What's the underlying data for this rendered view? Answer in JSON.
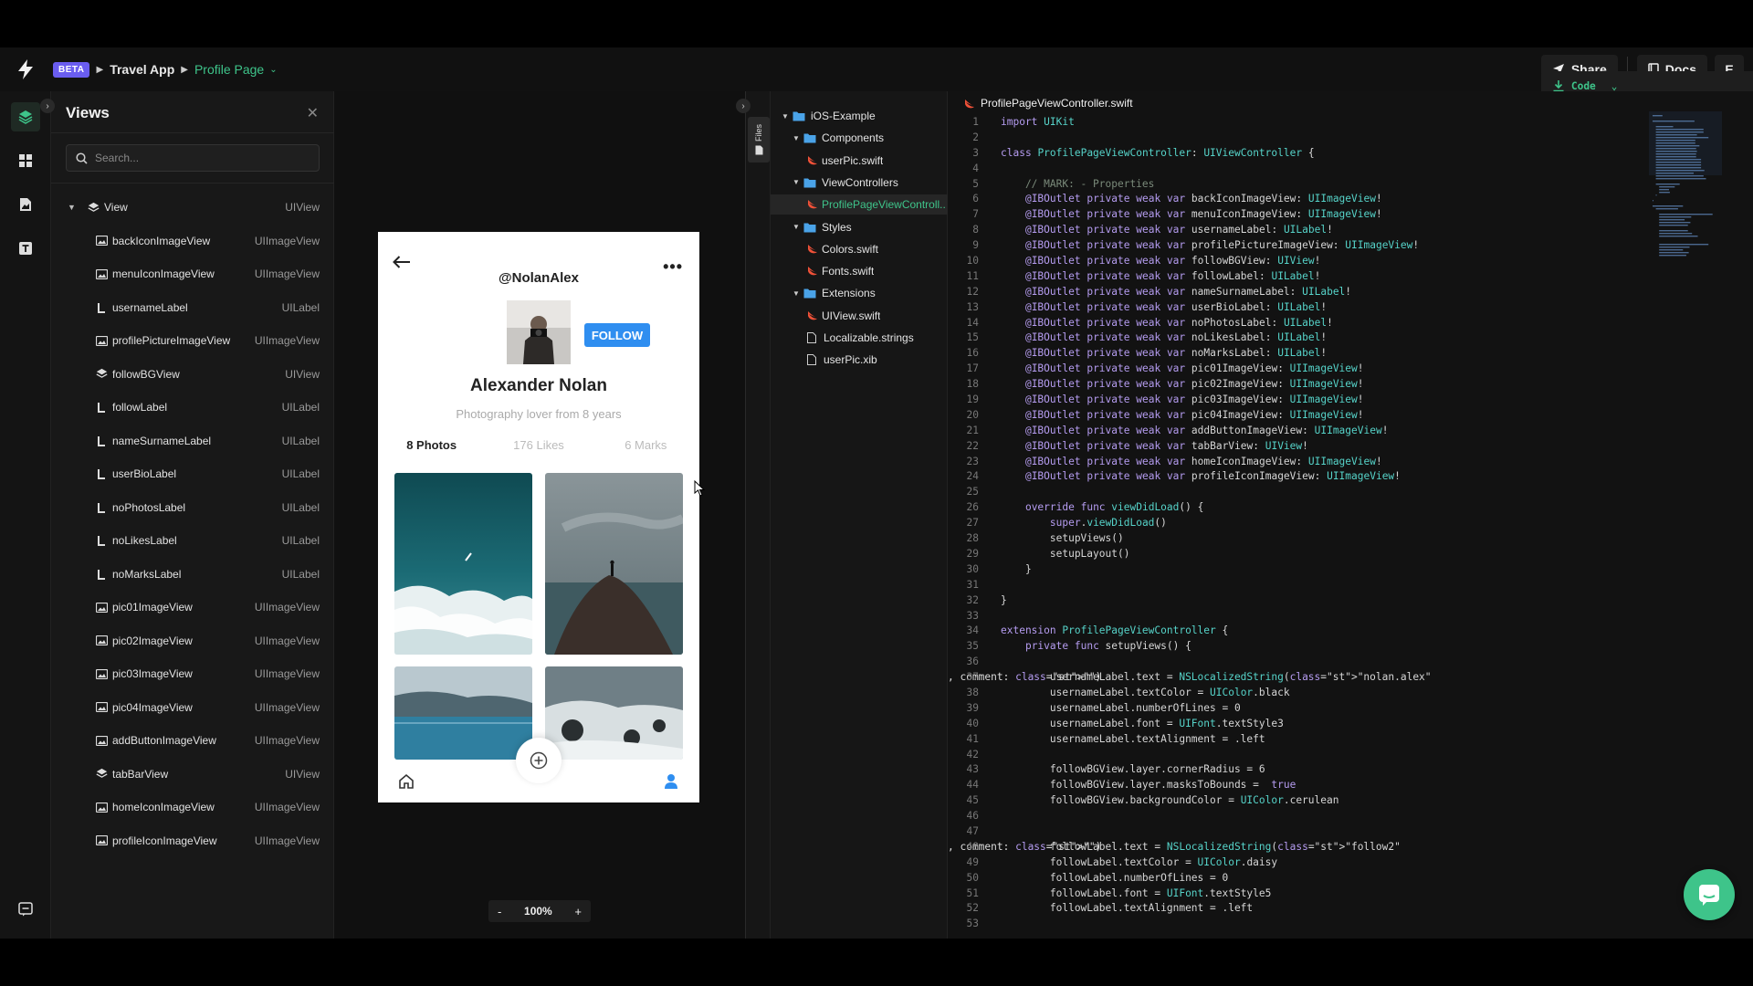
{
  "topbar": {
    "beta": "BETA",
    "project": "Travel App",
    "page": "Profile Page",
    "code_label": "Code",
    "share_label": "Share",
    "docs_label": "Docs",
    "avatar_initial": "E"
  },
  "views_panel": {
    "title": "Views",
    "search_placeholder": "Search...",
    "root": {
      "name": "View",
      "type": "UIView"
    },
    "items": [
      {
        "name": "backIconImageView",
        "type": "UIImageView",
        "icon": "image-icon"
      },
      {
        "name": "menuIconImageView",
        "type": "UIImageView",
        "icon": "image-icon"
      },
      {
        "name": "usernameLabel",
        "type": "UILabel",
        "icon": "label-icon"
      },
      {
        "name": "profilePictureImageView",
        "type": "UIImageView",
        "icon": "image-icon"
      },
      {
        "name": "followBGView",
        "type": "UIView",
        "icon": "layers-icon"
      },
      {
        "name": "followLabel",
        "type": "UILabel",
        "icon": "label-icon"
      },
      {
        "name": "nameSurnameLabel",
        "type": "UILabel",
        "icon": "label-icon"
      },
      {
        "name": "userBioLabel",
        "type": "UILabel",
        "icon": "label-icon"
      },
      {
        "name": "noPhotosLabel",
        "type": "UILabel",
        "icon": "label-icon"
      },
      {
        "name": "noLikesLabel",
        "type": "UILabel",
        "icon": "label-icon"
      },
      {
        "name": "noMarksLabel",
        "type": "UILabel",
        "icon": "label-icon"
      },
      {
        "name": "pic01ImageView",
        "type": "UIImageView",
        "icon": "image-icon"
      },
      {
        "name": "pic02ImageView",
        "type": "UIImageView",
        "icon": "image-icon"
      },
      {
        "name": "pic03ImageView",
        "type": "UIImageView",
        "icon": "image-icon"
      },
      {
        "name": "pic04ImageView",
        "type": "UIImageView",
        "icon": "image-icon"
      },
      {
        "name": "addButtonImageView",
        "type": "UIImageView",
        "icon": "image-icon"
      },
      {
        "name": "tabBarView",
        "type": "UIView",
        "icon": "layers-icon"
      },
      {
        "name": "homeIconImageView",
        "type": "UIImageView",
        "icon": "image-icon"
      },
      {
        "name": "profileIconImageView",
        "type": "UIImageView",
        "icon": "image-icon"
      }
    ]
  },
  "preview": {
    "username": "@NolanAlex",
    "follow": "FOLLOW",
    "name": "Alexander Nolan",
    "bio": "Photography lover from 8 years",
    "photos": "8 Photos",
    "likes": "176 Likes",
    "marks": "6 Marks",
    "zoom": "100%",
    "zoom_minus": "-",
    "zoom_plus": "+"
  },
  "files": {
    "strip_label": "Files",
    "tree": [
      {
        "name": "iOS-Example",
        "kind": "folder",
        "depth": 0,
        "open": true
      },
      {
        "name": "Components",
        "kind": "folder",
        "depth": 1,
        "open": true
      },
      {
        "name": "userPic.swift",
        "kind": "swift",
        "depth": 2
      },
      {
        "name": "ViewControllers",
        "kind": "folder",
        "depth": 1,
        "open": true
      },
      {
        "name": "ProfilePageViewControll...",
        "kind": "swift",
        "depth": 2,
        "selected": true
      },
      {
        "name": "Styles",
        "kind": "folder",
        "depth": 1,
        "open": true
      },
      {
        "name": "Colors.swift",
        "kind": "swift",
        "depth": 2
      },
      {
        "name": "Fonts.swift",
        "kind": "swift",
        "depth": 2
      },
      {
        "name": "Extensions",
        "kind": "folder",
        "depth": 1,
        "open": true
      },
      {
        "name": "UIView.swift",
        "kind": "swift",
        "depth": 2
      },
      {
        "name": "Localizable.strings",
        "kind": "file",
        "depth": 1
      },
      {
        "name": "userPic.xib",
        "kind": "file",
        "depth": 1
      }
    ]
  },
  "editor": {
    "filename": "ProfilePageViewController.swift",
    "lines": [
      "import UIKit",
      "",
      "class ProfilePageViewController: UIViewController {",
      "",
      "    // MARK: - Properties",
      "    @IBOutlet private weak var backIconImageView: UIImageView!",
      "    @IBOutlet private weak var menuIconImageView: UIImageView!",
      "    @IBOutlet private weak var usernameLabel: UILabel!",
      "    @IBOutlet private weak var profilePictureImageView: UIImageView!",
      "    @IBOutlet private weak var followBGView: UIView!",
      "    @IBOutlet private weak var followLabel: UILabel!",
      "    @IBOutlet private weak var nameSurnameLabel: UILabel!",
      "    @IBOutlet private weak var userBioLabel: UILabel!",
      "    @IBOutlet private weak var noPhotosLabel: UILabel!",
      "    @IBOutlet private weak var noLikesLabel: UILabel!",
      "    @IBOutlet private weak var noMarksLabel: UILabel!",
      "    @IBOutlet private weak var pic01ImageView: UIImageView!",
      "    @IBOutlet private weak var pic02ImageView: UIImageView!",
      "    @IBOutlet private weak var pic03ImageView: UIImageView!",
      "    @IBOutlet private weak var pic04ImageView: UIImageView!",
      "    @IBOutlet private weak var addButtonImageView: UIImageView!",
      "    @IBOutlet private weak var tabBarView: UIView!",
      "    @IBOutlet private weak var homeIconImageView: UIImageView!",
      "    @IBOutlet private weak var profileIconImageView: UIImageView!",
      "",
      "    override func viewDidLoad() {",
      "        super.viewDidLoad()",
      "        setupViews()",
      "        setupLayout()",
      "    }",
      "",
      "}",
      "",
      "extension ProfilePageViewController {",
      "    private func setupViews() {",
      "",
      "        usernameLabel.text = NSLocalizedString(\"nolan.alex\", comment: \"\")",
      "        usernameLabel.textColor = UIColor.black",
      "        usernameLabel.numberOfLines = 0",
      "        usernameLabel.font = UIFont.textStyle3",
      "        usernameLabel.textAlignment = .left",
      "",
      "        followBGView.layer.cornerRadius = 6",
      "        followBGView.layer.masksToBounds =  true",
      "        followBGView.backgroundColor = UIColor.cerulean",
      "",
      "",
      "        followLabel.text = NSLocalizedString(\"follow2\", comment: \"\")",
      "        followLabel.textColor = UIColor.daisy",
      "        followLabel.numberOfLines = 0",
      "        followLabel.font = UIFont.textStyle5",
      "        followLabel.textAlignment = .left",
      ""
    ]
  },
  "colors": {
    "accent": "#3ec48a",
    "beta": "#6a5df0",
    "follow_button": "#2f8ef0",
    "keyword": "#b59cf0",
    "type": "#56d3c9"
  }
}
